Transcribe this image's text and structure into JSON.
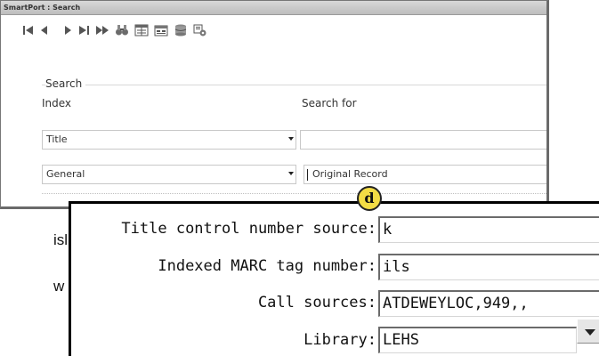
{
  "window": {
    "title": "SmartPort : Search"
  },
  "toolbar": {
    "buttons": [
      {
        "name": "first-record-icon"
      },
      {
        "name": "previous-record-icon"
      },
      {
        "name": "next-record-icon"
      },
      {
        "name": "last-record-icon"
      },
      {
        "name": "fast-forward-icon"
      },
      {
        "name": "search-binoculars-icon"
      },
      {
        "name": "record-icon"
      },
      {
        "name": "import-icon"
      },
      {
        "name": "database-icon"
      },
      {
        "name": "settings-icon"
      }
    ]
  },
  "search": {
    "group_label": "Search",
    "index_label": "Index",
    "search_for_label": "Search for",
    "index_1": "Title",
    "index_2": "General",
    "search_for_1": "",
    "search_for_2": "Original Record"
  },
  "stray_text": {
    "line1": "isl",
    "line2": "w"
  },
  "details": {
    "badge": "d",
    "rows": [
      {
        "label": "Title control number source:",
        "value": "k"
      },
      {
        "label": "Indexed MARC tag number:",
        "value": "ils"
      },
      {
        "label": "Call sources:",
        "value": "ATDEWEYLOC,949,,"
      },
      {
        "label": "Library:",
        "value": "LEHS"
      }
    ]
  },
  "colors": {
    "badge_fill": "#f3dc45",
    "panel_border": "#000000"
  }
}
